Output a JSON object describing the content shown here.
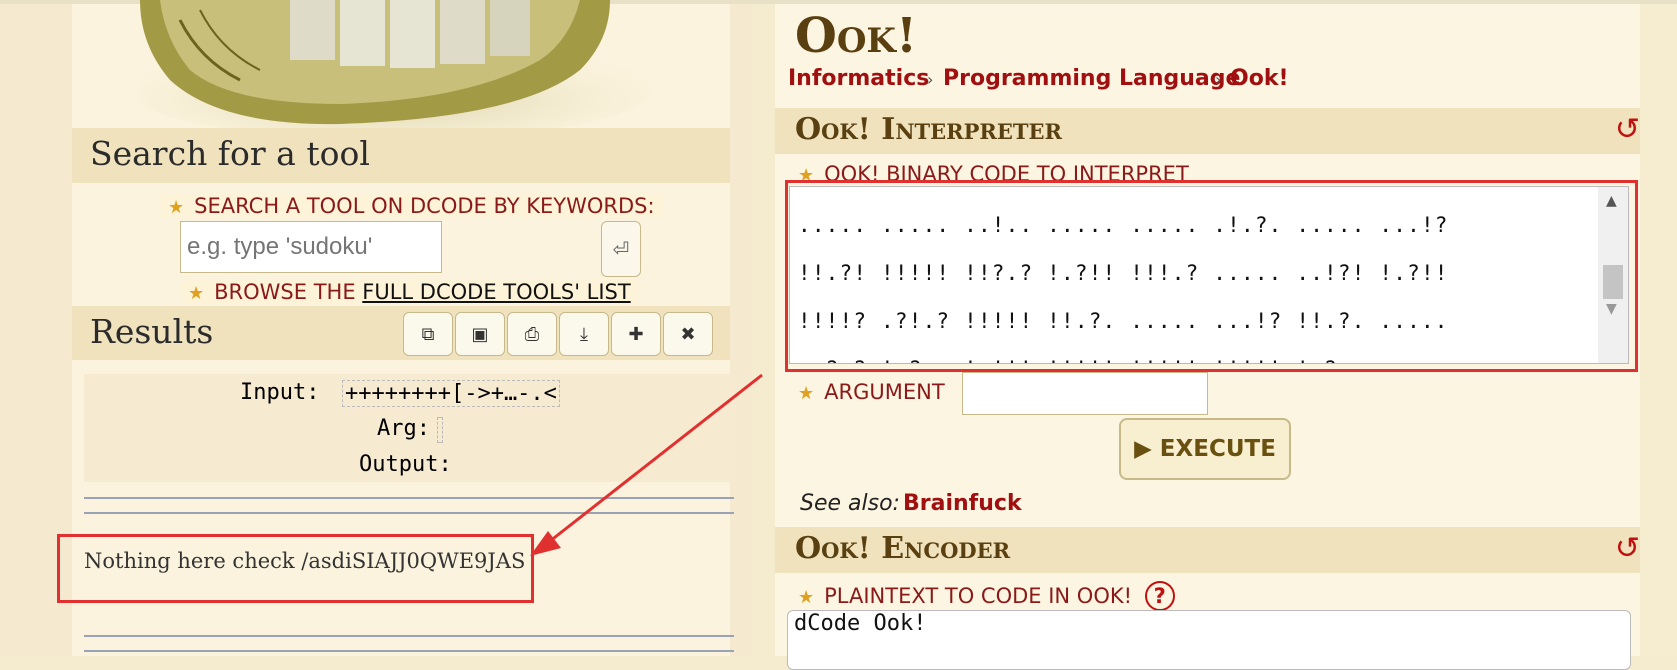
{
  "left": {
    "search_heading": "Search for a tool",
    "search_label": "SEARCH A TOOL ON DCODE BY KEYWORDS:",
    "search_placeholder": "e.g. type 'sudoku'",
    "enter_glyph": "⏎",
    "browse_prefix": "BROWSE THE ",
    "browse_link": "FULL DCODE TOOLS' LIST",
    "results_heading": "Results",
    "toolbar_icons": [
      "copy-icon",
      "save-icon",
      "print-icon",
      "download-icon",
      "pin-icon",
      "close-icon"
    ],
    "input_label": "Input:",
    "input_value": "++++++++[->+…-.<",
    "arg_label": "Arg:",
    "output_label": "Output:",
    "result_text": "Nothing here check /asdiSIAJJ0QWE9JAS"
  },
  "right": {
    "title": "Ook!",
    "breadcrumb": [
      "Informatics",
      "Programming Language",
      "Ook!"
    ],
    "interpreter_title": "Ook! Interpreter",
    "code_label": "OOK! BINARY CODE TO INTERPRET",
    "code_lines": [
      "..... ..... ..!.. ..... ..... .!.?. ..... ...!?",
      "!!.?! !!!!! !!?.? !.?!! !!!.? ..... ..!?! !.?!!",
      "!!!!? .?!.? !!!!! !!.?. ..... ...!? !!.?. .....",
      "..?.? !.?.. !.!!! !!!!! !!!!! !!!!! !.?.. .....",
      "..!?! !.?.. ..... .?.?! .?... !.?.. ..... .....",
      "..... .!?!! .?!!! !!!!! !!!!! !!!?. ?!.?! !!!!!",
      "!!!!! !!.!! !!!!! ..... ..!.! !!!!! !.?."
    ],
    "argument_label": "ARGUMENT",
    "execute_label": "▶ EXECUTE",
    "see_also_label": "See also:",
    "see_also_link": "Brainfuck",
    "encoder_title": "Ook! Encoder",
    "plaintext_label": "PLAINTEXT TO CODE IN OOK!",
    "help_glyph": "?",
    "plaintext_value": "dCode Ook!",
    "reset_glyph": "↺"
  },
  "colors": {
    "accent_red": "#a01010",
    "annotation_red": "#e03030",
    "header_bg": "#efe2bd"
  }
}
